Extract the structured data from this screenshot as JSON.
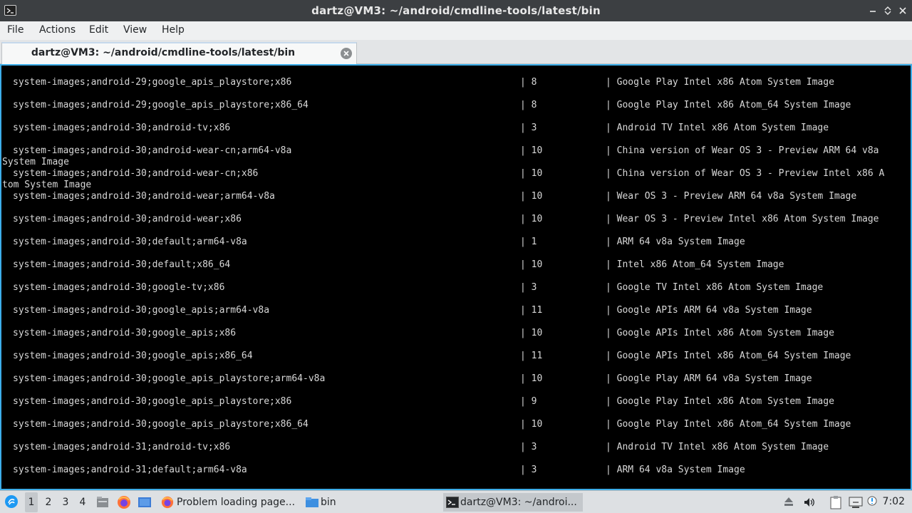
{
  "window": {
    "title": "dartz@VM3: ~/android/cmdline-tools/latest/bin"
  },
  "menubar": {
    "items": [
      "File",
      "Actions",
      "Edit",
      "View",
      "Help"
    ]
  },
  "tabs": [
    {
      "label": "dartz@VM3: ~/android/cmdline-tools/latest/bin"
    }
  ],
  "terminal": {
    "rows": [
      {
        "path": "system-images;android-29;google_apis_playstore;x86",
        "version": "8",
        "desc": "Google Play Intel x86 Atom System Image"
      },
      {
        "path": "system-images;android-29;google_apis_playstore;x86_64",
        "version": "8",
        "desc": "Google Play Intel x86 Atom_64 System Image"
      },
      {
        "path": "system-images;android-30;android-tv;x86",
        "version": "3",
        "desc": "Android TV Intel x86 Atom System Image"
      },
      {
        "path": "system-images;android-30;android-wear-cn;arm64-v8a",
        "version": "10",
        "desc": "China version of Wear OS 3 - Preview ARM 64 v8a",
        "wrap": "System Image"
      },
      {
        "path": "system-images;android-30;android-wear-cn;x86",
        "version": "10",
        "desc": "China version of Wear OS 3 - Preview Intel x86 A",
        "wrap": "tom System Image"
      },
      {
        "path": "system-images;android-30;android-wear;arm64-v8a",
        "version": "10",
        "desc": "Wear OS 3 - Preview ARM 64 v8a System Image"
      },
      {
        "path": "system-images;android-30;android-wear;x86",
        "version": "10",
        "desc": "Wear OS 3 - Preview Intel x86 Atom System Image"
      },
      {
        "path": "system-images;android-30;default;arm64-v8a",
        "version": "1",
        "desc": "ARM 64 v8a System Image"
      },
      {
        "path": "system-images;android-30;default;x86_64",
        "version": "10",
        "desc": "Intel x86 Atom_64 System Image"
      },
      {
        "path": "system-images;android-30;google-tv;x86",
        "version": "3",
        "desc": "Google TV Intel x86 Atom System Image"
      },
      {
        "path": "system-images;android-30;google_apis;arm64-v8a",
        "version": "11",
        "desc": "Google APIs ARM 64 v8a System Image"
      },
      {
        "path": "system-images;android-30;google_apis;x86",
        "version": "10",
        "desc": "Google APIs Intel x86 Atom System Image"
      },
      {
        "path": "system-images;android-30;google_apis;x86_64",
        "version": "11",
        "desc": "Google APIs Intel x86 Atom_64 System Image"
      },
      {
        "path": "system-images;android-30;google_apis_playstore;arm64-v8a",
        "version": "10",
        "desc": "Google Play ARM 64 v8a System Image"
      },
      {
        "path": "system-images;android-30;google_apis_playstore;x86",
        "version": "9",
        "desc": "Google Play Intel x86 Atom System Image"
      },
      {
        "path": "system-images;android-30;google_apis_playstore;x86_64",
        "version": "10",
        "desc": "Google Play Intel x86 Atom_64 System Image"
      },
      {
        "path": "system-images;android-31;android-tv;x86",
        "version": "3",
        "desc": "Android TV Intel x86 Atom System Image"
      },
      {
        "path": "system-images;android-31;default;arm64-v8a",
        "version": "3",
        "desc": "ARM 64 v8a System Image"
      }
    ],
    "separator": "|"
  },
  "taskbar": {
    "workspaces": [
      "1",
      "2",
      "3",
      "4"
    ],
    "tasks": [
      {
        "label": "Problem loading page...",
        "icon": "firefox-icon"
      },
      {
        "label": "bin",
        "icon": "folder-icon"
      },
      {
        "label": "dartz@VM3: ~/androi...",
        "icon": "terminal-icon"
      }
    ],
    "clock": "7:02"
  },
  "colors": {
    "terminal_bg": "#000000",
    "terminal_fg": "#d8d8d8",
    "focus_border": "#3daee9",
    "titlebar_bg": "#3c3f42"
  }
}
